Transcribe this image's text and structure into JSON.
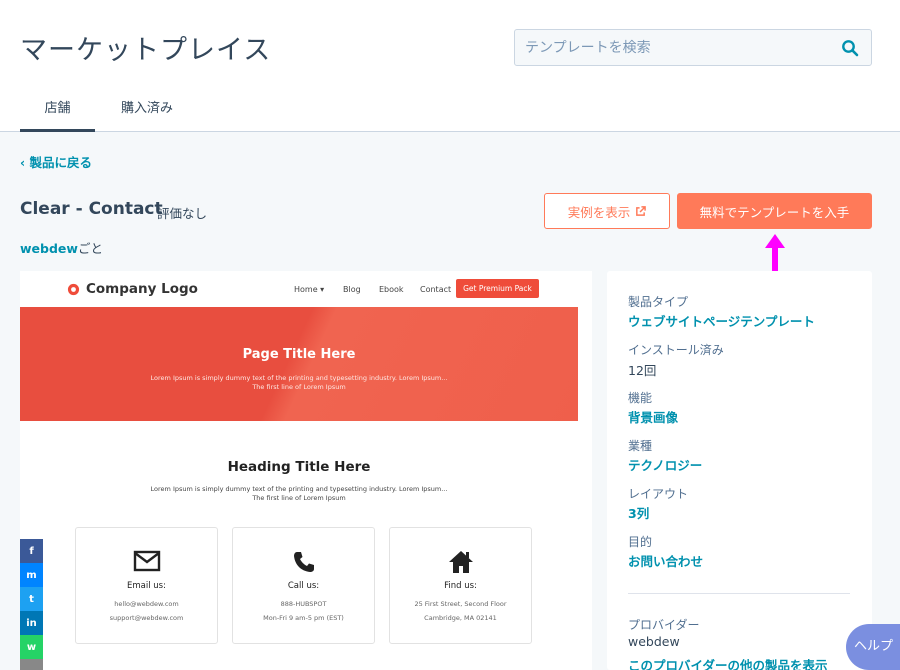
{
  "header": {
    "title": "マーケットプレイス",
    "search_placeholder": "テンプレートを検索",
    "tabs": [
      {
        "label": "店舗"
      },
      {
        "label": "購入済み"
      }
    ]
  },
  "product": {
    "back_label": "製品に戻る",
    "name": "Clear - Contact",
    "rating": "評価なし",
    "vendor_name": "webdew",
    "vendor_suffix": "ごと",
    "example_button": "実例を表示",
    "get_button": "無料でテンプレートを入手"
  },
  "preview": {
    "logo_text": "Company Logo",
    "nav": [
      "Home ▾",
      "Blog",
      "Ebook",
      "Contact"
    ],
    "premium_button": "Get Premium Pack",
    "hero_title": "Page Title Here",
    "hero_text_1": "Lorem Ipsum is simply dummy text of the printing and typesetting industry. Lorem Ipsum...",
    "hero_text_2": "The first line of Lorem Ipsum",
    "heading": "Heading Title Here",
    "heading_text_1": "Lorem Ipsum is simply dummy text of the printing and typesetting industry. Lorem Ipsum...",
    "heading_text_2": "The first line of Lorem Ipsum",
    "cards": [
      {
        "title": "Email us:",
        "line1": "hello@webdew.com",
        "line2": "support@webdew.com"
      },
      {
        "title": "Call us:",
        "line1": "888-HUBSPOT",
        "line2": "Mon-Fri 9 am-5 pm (EST)"
      },
      {
        "title": "Find us:",
        "line1": "25 First Street, Second Floor",
        "line2": "Cambridge, MA 02141"
      }
    ],
    "social": [
      "f",
      "m",
      "t",
      "in",
      "w"
    ]
  },
  "details": [
    {
      "label": "製品タイプ",
      "value": "ウェブサイトページテンプレート"
    },
    {
      "label": "インストール済み",
      "value": "12回"
    },
    {
      "label": "機能",
      "value": "背景画像"
    },
    {
      "label": "業種",
      "value": "テクノロジー"
    },
    {
      "label": "レイアウト",
      "value": "3列"
    },
    {
      "label": "目的",
      "value": "お問い合わせ"
    }
  ],
  "provider": {
    "label": "プロバイダー",
    "name": "webdew",
    "more_link": "このプロバイダーの他の製品を表示"
  },
  "help_label": "ヘルプ",
  "colors": {
    "accent": "#ff7a59",
    "link": "#0091ae",
    "text": "#33475b",
    "arrow": "#ff00ff"
  }
}
